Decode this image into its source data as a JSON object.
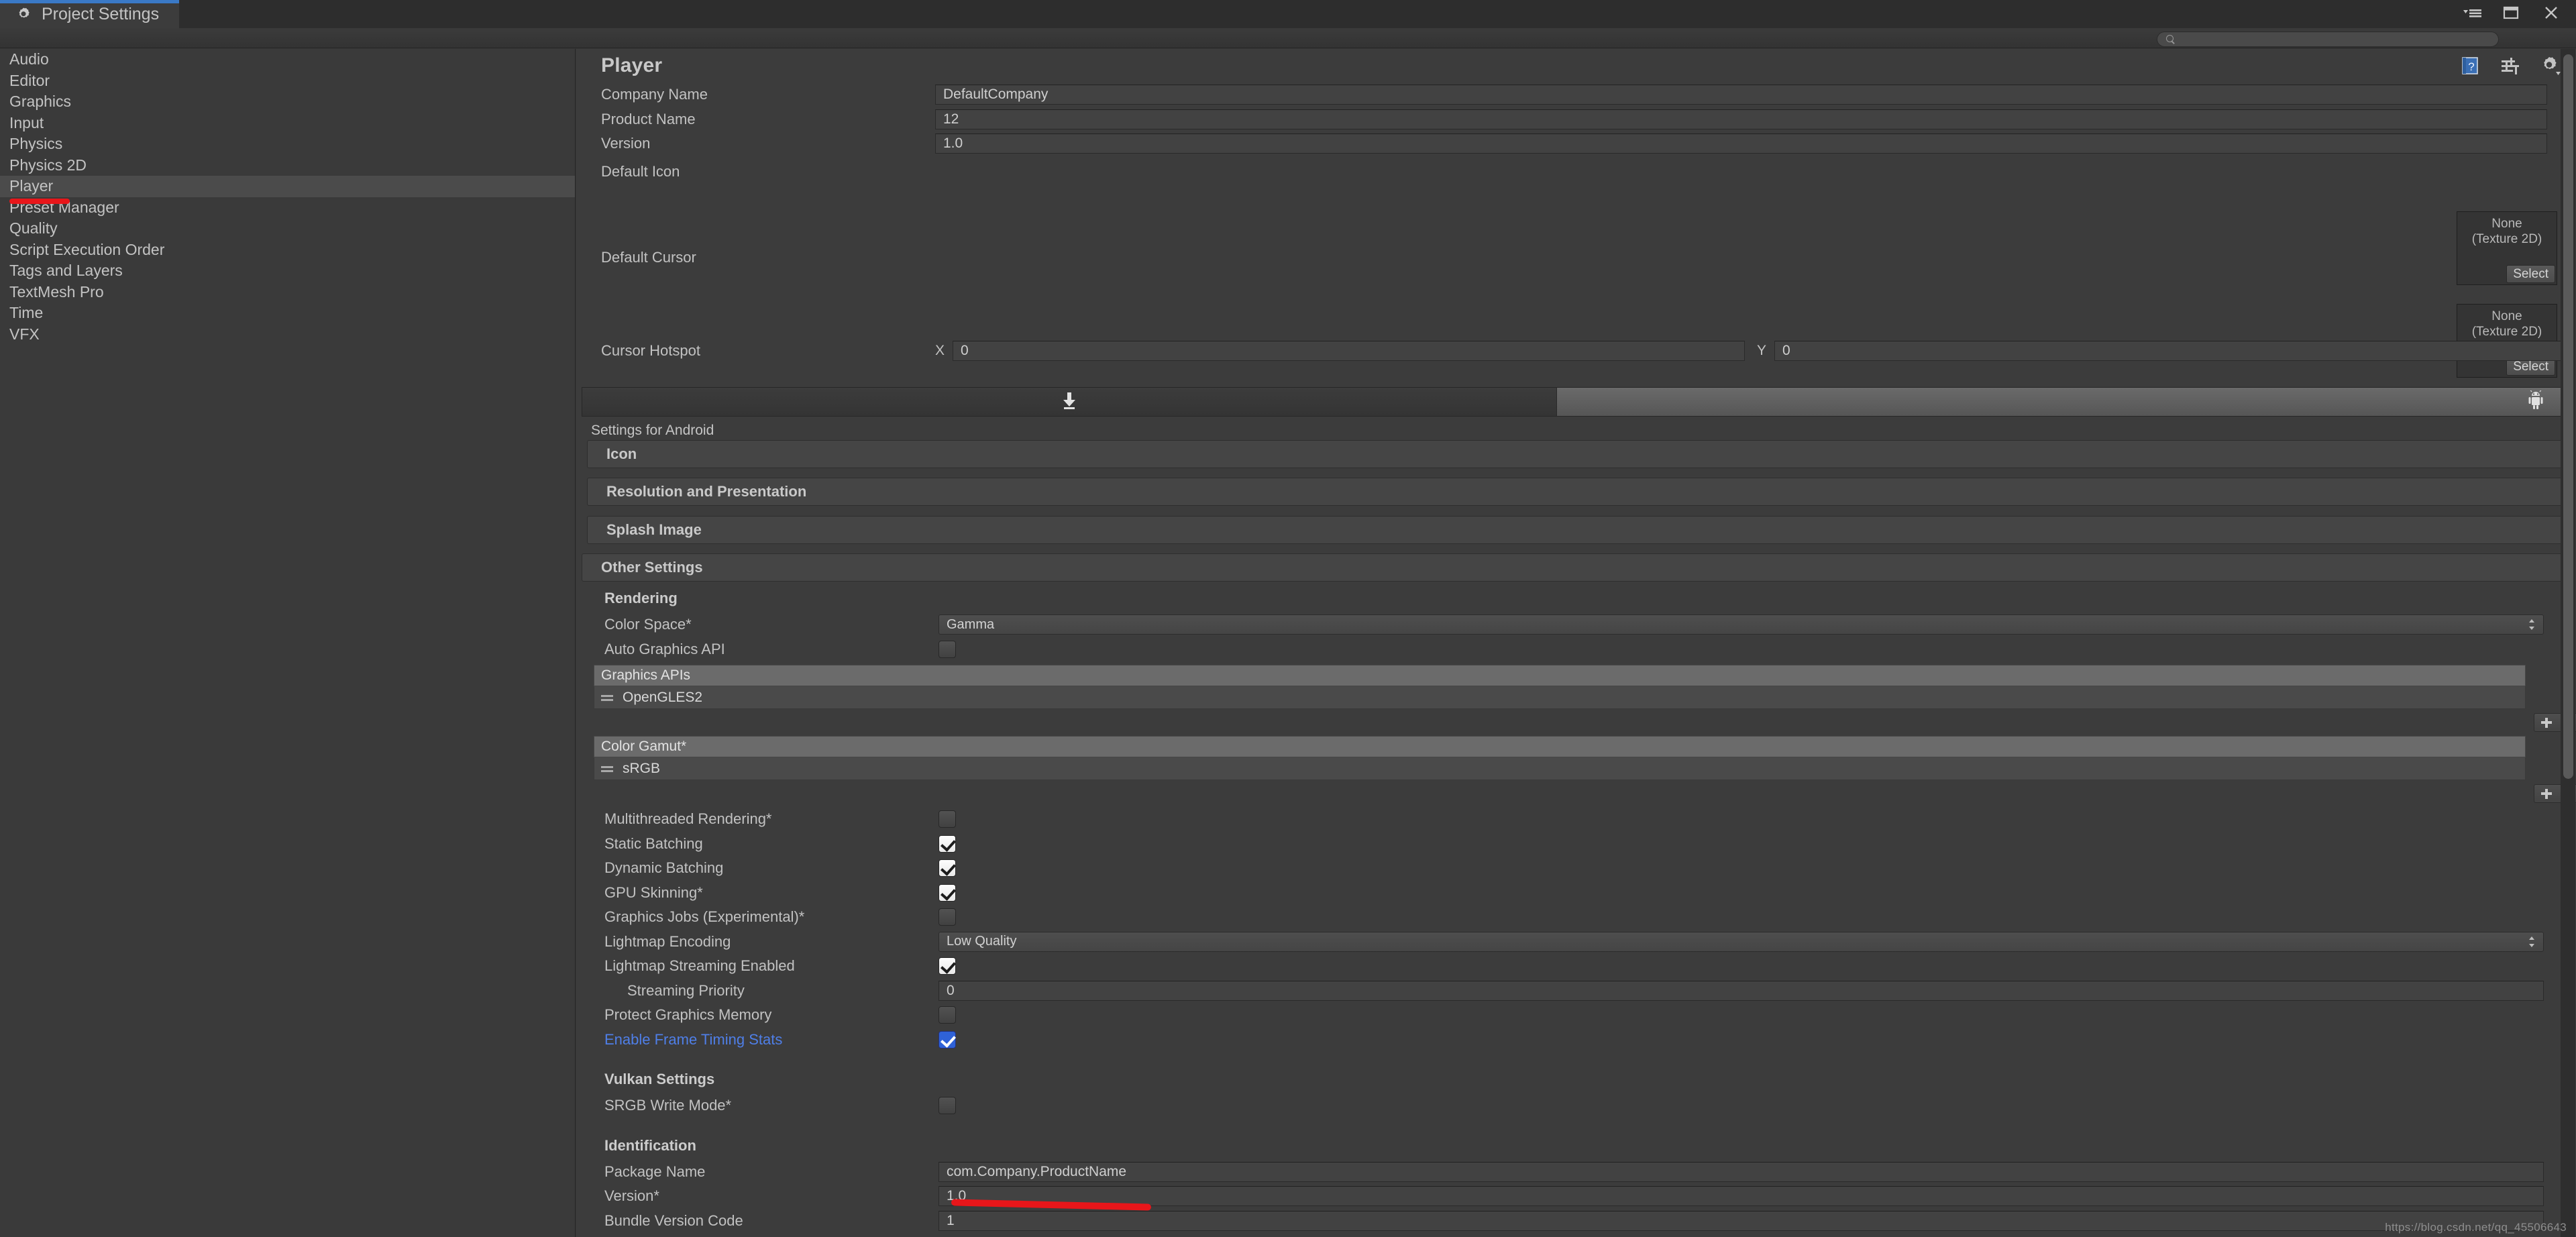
{
  "window": {
    "tab_label": "Project Settings",
    "tab_icon": "gear-icon",
    "controls": [
      {
        "name": "window-menu-icon",
        "glyph": "menu"
      },
      {
        "name": "maximize-icon",
        "glyph": "maximize"
      },
      {
        "name": "close-icon",
        "glyph": "close"
      }
    ]
  },
  "search": {
    "value": "",
    "placeholder": "",
    "icon": "search-icon"
  },
  "sidebar": {
    "items": [
      {
        "label": "Audio",
        "selected": false
      },
      {
        "label": "Editor",
        "selected": false
      },
      {
        "label": "Graphics",
        "selected": false
      },
      {
        "label": "Input",
        "selected": false
      },
      {
        "label": "Physics",
        "selected": false
      },
      {
        "label": "Physics 2D",
        "selected": false
      },
      {
        "label": "Player",
        "selected": true
      },
      {
        "label": "Preset Manager",
        "selected": false
      },
      {
        "label": "Quality",
        "selected": false
      },
      {
        "label": "Script Execution Order",
        "selected": false
      },
      {
        "label": "Tags and Layers",
        "selected": false
      },
      {
        "label": "TextMesh Pro",
        "selected": false
      },
      {
        "label": "Time",
        "selected": false
      },
      {
        "label": "VFX",
        "selected": false
      }
    ]
  },
  "panel": {
    "title": "Player",
    "header_icons": [
      {
        "name": "help-book-icon"
      },
      {
        "name": "preset-icon"
      },
      {
        "name": "gear-menu-icon"
      }
    ],
    "general": {
      "company_name": {
        "label": "Company Name",
        "value": "DefaultCompany"
      },
      "product_name": {
        "label": "Product Name",
        "value": "12"
      },
      "version": {
        "label": "Version",
        "value": "1.0"
      },
      "default_icon": {
        "label": "Default Icon",
        "value": "None",
        "type": "(Texture 2D)",
        "select_label": "Select"
      },
      "default_cursor": {
        "label": "Default Cursor",
        "value": "None",
        "type": "(Texture 2D)",
        "select_label": "Select"
      },
      "cursor_hotspot": {
        "label": "Cursor Hotspot",
        "x_label": "X",
        "x_value": "0",
        "y_label": "Y",
        "y_value": "0"
      }
    },
    "platform_tabs": [
      {
        "icon": "standalone-download-icon",
        "active": false
      },
      {
        "icon": "android-robot-icon",
        "active": true
      }
    ],
    "settings_for": "Settings for Android",
    "foldouts": [
      {
        "label": "Icon",
        "expanded": false
      },
      {
        "label": "Resolution and Presentation",
        "expanded": false
      },
      {
        "label": "Splash Image",
        "expanded": false
      },
      {
        "label": "Other Settings",
        "expanded": true
      }
    ],
    "other_settings": {
      "rendering": {
        "heading": "Rendering",
        "color_space": {
          "label": "Color Space*",
          "value": "Gamma"
        },
        "auto_graphics_api": {
          "label": "Auto Graphics API",
          "checked": false
        },
        "graphics_apis": {
          "header": "Graphics APIs",
          "items": [
            "OpenGLES2"
          ]
        },
        "color_gamut": {
          "header": "Color Gamut*",
          "items": [
            "sRGB"
          ]
        },
        "multithreaded_rendering": {
          "label": "Multithreaded Rendering*",
          "checked": false
        },
        "static_batching": {
          "label": "Static Batching",
          "checked": true
        },
        "dynamic_batching": {
          "label": "Dynamic Batching",
          "checked": true
        },
        "gpu_skinning": {
          "label": "GPU Skinning*",
          "checked": true
        },
        "graphics_jobs": {
          "label": "Graphics Jobs (Experimental)*",
          "checked": false
        },
        "lightmap_encoding": {
          "label": "Lightmap Encoding",
          "value": "Low Quality"
        },
        "lightmap_streaming_enabled": {
          "label": "Lightmap Streaming Enabled",
          "checked": true
        },
        "streaming_priority": {
          "label": "Streaming Priority",
          "value": "0"
        },
        "protect_graphics_memory": {
          "label": "Protect Graphics Memory",
          "checked": false
        },
        "enable_frame_timing_stats": {
          "label": "Enable Frame Timing Stats",
          "checked": true,
          "highlight": true
        }
      },
      "vulkan": {
        "heading": "Vulkan Settings",
        "srgb_write_mode": {
          "label": "SRGB Write Mode*",
          "checked": false
        }
      },
      "identification": {
        "heading": "Identification",
        "package_name": {
          "label": "Package Name",
          "value": "com.Company.ProductName"
        },
        "version": {
          "label": "Version*",
          "value": "1.0"
        },
        "bundle_version_code": {
          "label": "Bundle Version Code",
          "value": "1"
        }
      }
    },
    "list_buttons": {
      "add": "+",
      "remove": "−"
    }
  },
  "annotations": {
    "color": "#e8161a",
    "marks": [
      {
        "target": "sidebar-item-player"
      },
      {
        "target": "package-name-field"
      }
    ]
  },
  "watermark": "https://blog.csdn.net/qq_45506643"
}
